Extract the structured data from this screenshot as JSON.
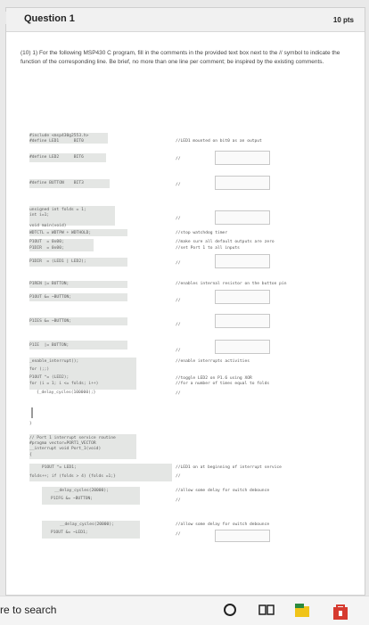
{
  "question": {
    "title": "Question 1",
    "points": "10 pts",
    "prompt": "(10) 1) For the following MSP430 C program, fill in the comments in the provided text box next to the // symbol to indicate the function of the corresponding line. Be brief, no more than one line per comment; be inspired by the existing comments."
  },
  "code": {
    "l01": "#include <msp430g2553.h>",
    "l02": "#define LED1      BIT0",
    "l03": "#define LED2      BIT6",
    "l04": "#define BUTTON    BIT3",
    "l05": "unsigned int folds = 1;",
    "l06": "int i=1;",
    "l07": "void main(void)",
    "l08": "WDTCTL = WDTPW + WDTHOLD;",
    "l09": "P1OUT  = 0x00;",
    "l10": "P1DIR  = 0x00;",
    "l11": "P1DIR  = (LED1 | LED2);",
    "l12": "P1REN |= BUTTON;",
    "l13": "P1OUT &= ~BUTTON;",
    "l14": "P1IES &= ~BUTTON;",
    "l15": "P1IE  |= BUTTON;",
    "l16": "_enable_interrupt();",
    "l17": "for (;;)",
    "l18": "P1OUT ^= (LED2);",
    "l19": "for (i = 1; i <= folds; i++)",
    "l20": "{_delay_cycles(100000);}",
    "l21": "}",
    "l22": "// Port 1 interrupt service routine",
    "l23": "#pragma vector=PORT1_VECTOR",
    "l24": "__interrupt void Port_1(void)",
    "l25": "{",
    "l26": "P1OUT ^= LED1;",
    "l27": "folds++; if (folds > 4) {folds =1;}",
    "l28": "__delay_cycles(20000);",
    "l29": "P1IFG &= ~BUTTON;",
    "l30": "__delay_cycles(20000);",
    "l31": "P1OUT &= ~LED1;"
  },
  "comments": {
    "c01": "//LED1 mounted on bit0 as an output",
    "c02": "//",
    "c03": "//",
    "c04": "//",
    "c05": "//stop watchdog timer",
    "c06": "//make sure all default outputs are zero",
    "c07": "//set Port 1 to all inputs",
    "c08": "//",
    "c09": "//enables internal resistor on the button pin",
    "c10": "//",
    "c11": "//",
    "c12": "//",
    "c13": "//enable interrupts activities",
    "c14": "//toggle LED2 on P1.6 using XOR",
    "c15": "//for a number of times equal to folds",
    "c16": "//",
    "c17": "//LED1 on at beginning of interrupt service",
    "c18": "//",
    "c19": "//allow some delay for switch debounce",
    "c20": "//",
    "c21": "//allow some delay for switch debounce",
    "c22": "//"
  },
  "taskbar": {
    "search_text": "re to search"
  }
}
